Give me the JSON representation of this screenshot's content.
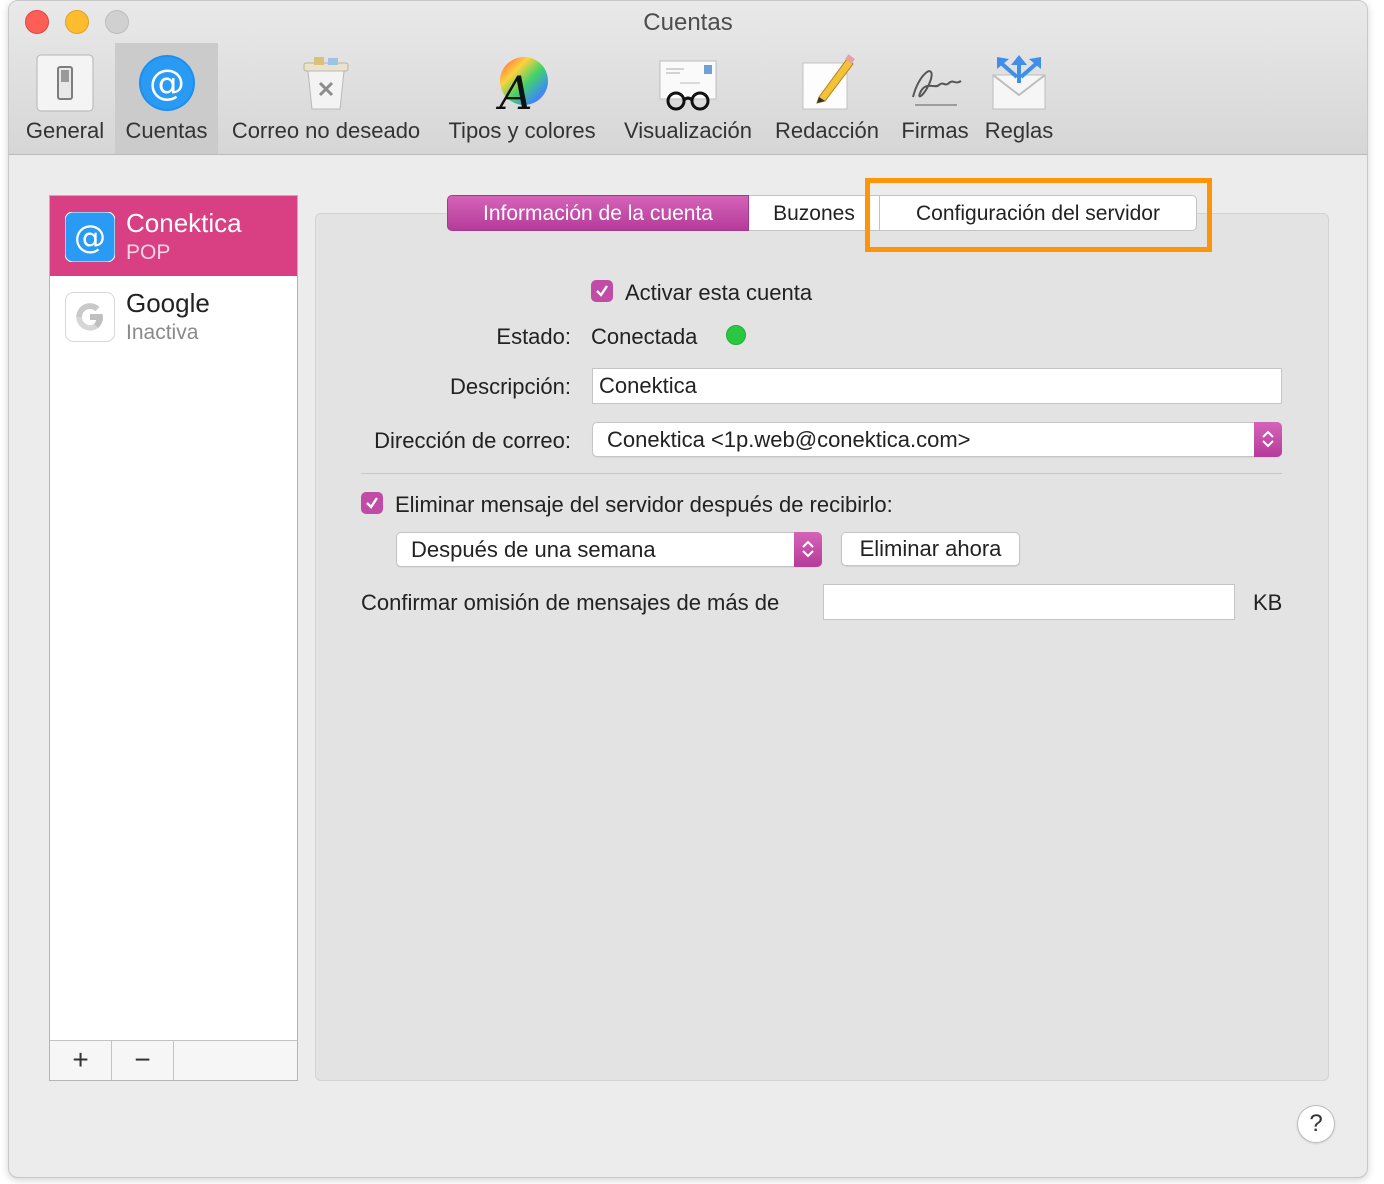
{
  "window": {
    "title": "Cuentas"
  },
  "toolbar": {
    "items": [
      {
        "label": "General",
        "icon": "switch-icon"
      },
      {
        "label": "Cuentas",
        "icon": "at-sign-icon",
        "active": true
      },
      {
        "label": "Correo no deseado",
        "icon": "junk-trash-icon"
      },
      {
        "label": "Tipos y colores",
        "icon": "fonts-colors-icon"
      },
      {
        "label": "Visualización",
        "icon": "glasses-envelope-icon"
      },
      {
        "label": "Redacción",
        "icon": "pencil-paper-icon"
      },
      {
        "label": "Firmas",
        "icon": "signature-icon"
      },
      {
        "label": "Reglas",
        "icon": "rules-envelope-icon"
      }
    ]
  },
  "accounts": [
    {
      "name": "Conektica",
      "type": "POP",
      "selected": true
    },
    {
      "name": "Google",
      "type": "Inactiva",
      "selected": false
    }
  ],
  "list_footer": {
    "add": "+",
    "remove": "−"
  },
  "tabs": {
    "info": "Información de la cuenta",
    "mailboxes": "Buzones",
    "server": "Configuración del servidor"
  },
  "form": {
    "enable_label": "Activar esta cuenta",
    "enable_checked": true,
    "status_label": "Estado:",
    "status_value": "Conectada",
    "description_label": "Descripción:",
    "description_value": "Conektica",
    "email_label": "Dirección de correo:",
    "email_value": "Conektica <1p.web@conektica.com>",
    "delete_label": "Eliminar mensaje del servidor después de recibirlo:",
    "delete_checked": true,
    "delete_when": "Después de una semana",
    "delete_now": "Eliminar ahora",
    "skip_label": "Confirmar omisión de mensajes de más de",
    "skip_value": "",
    "skip_unit": "KB"
  },
  "help": "?",
  "colors": {
    "accent": "#c04ca5",
    "selection": "#d93f83",
    "highlight": "#ff9408",
    "status_ok": "#2ac840"
  }
}
